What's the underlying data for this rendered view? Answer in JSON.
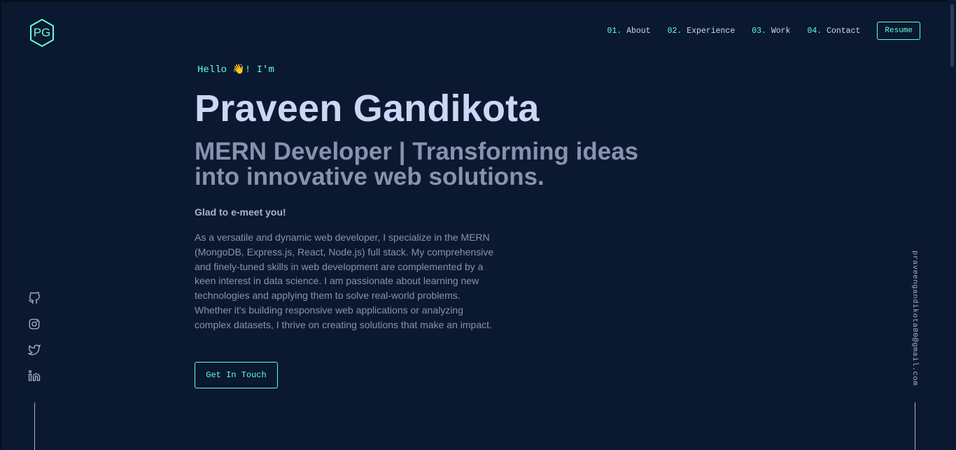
{
  "logo": {
    "text": "PG",
    "icon": "hexagon-logo-icon"
  },
  "nav": {
    "items": [
      {
        "num": "01.",
        "label": "About"
      },
      {
        "num": "02.",
        "label": "Experience"
      },
      {
        "num": "03.",
        "label": "Work"
      },
      {
        "num": "04.",
        "label": "Contact"
      }
    ],
    "resume_label": "Resume"
  },
  "hero": {
    "greeting": "Hello 👋! I'm",
    "name": "Praveen Gandikota",
    "tagline": "MERN Developer | Transforming ideas into innovative web solutions.",
    "glad": "Glad to e-meet you!",
    "bio": "As a versatile and dynamic web developer, I specialize in the MERN (MongoDB, Express.js, React, Node.js) full stack. My comprehensive and finely-tuned skills in web development are complemented by a keen interest in data science. I am passionate about learning new technologies and applying them to solve real-world problems. Whether it's building responsive web applications or analyzing complex datasets, I thrive on creating solutions that make an impact.",
    "cta_label": "Get In Touch"
  },
  "social": {
    "icons": [
      "github-icon",
      "instagram-icon",
      "twitter-icon",
      "linkedin-icon"
    ]
  },
  "email": "praveengandikota80@gmail.com",
  "colors": {
    "background": "#0a192f",
    "accent": "#64ffda",
    "heading": "#ccd6f6",
    "text": "#8892b0"
  }
}
